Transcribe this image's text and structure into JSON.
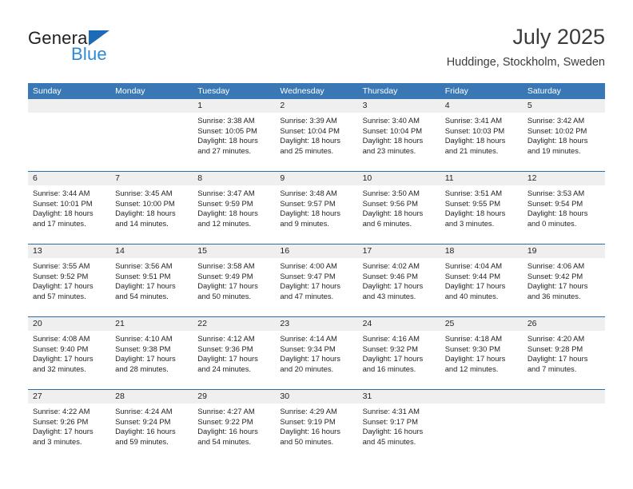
{
  "brand": {
    "name_top": "General",
    "name_bottom": "Blue",
    "triangle_color": "#1c6cb5",
    "blue_color": "#2e8ad6"
  },
  "header": {
    "title": "July 2025",
    "subtitle": "Huddinge, Stockholm, Sweden"
  },
  "theme": {
    "header_blue": "#3a78b5",
    "row_divider": "#2e6ca4",
    "day_band": "#efefef"
  },
  "weekdays": [
    "Sunday",
    "Monday",
    "Tuesday",
    "Wednesday",
    "Thursday",
    "Friday",
    "Saturday"
  ],
  "labels": {
    "sunrise": "Sunrise:",
    "sunset": "Sunset:",
    "daylight": "Daylight:"
  },
  "weeks": [
    [
      {
        "day": ""
      },
      {
        "day": ""
      },
      {
        "day": "1",
        "sunrise": "Sunrise: 3:38 AM",
        "sunset": "Sunset: 10:05 PM",
        "daylight": "Daylight: 18 hours and 27 minutes."
      },
      {
        "day": "2",
        "sunrise": "Sunrise: 3:39 AM",
        "sunset": "Sunset: 10:04 PM",
        "daylight": "Daylight: 18 hours and 25 minutes."
      },
      {
        "day": "3",
        "sunrise": "Sunrise: 3:40 AM",
        "sunset": "Sunset: 10:04 PM",
        "daylight": "Daylight: 18 hours and 23 minutes."
      },
      {
        "day": "4",
        "sunrise": "Sunrise: 3:41 AM",
        "sunset": "Sunset: 10:03 PM",
        "daylight": "Daylight: 18 hours and 21 minutes."
      },
      {
        "day": "5",
        "sunrise": "Sunrise: 3:42 AM",
        "sunset": "Sunset: 10:02 PM",
        "daylight": "Daylight: 18 hours and 19 minutes."
      }
    ],
    [
      {
        "day": "6",
        "sunrise": "Sunrise: 3:44 AM",
        "sunset": "Sunset: 10:01 PM",
        "daylight": "Daylight: 18 hours and 17 minutes."
      },
      {
        "day": "7",
        "sunrise": "Sunrise: 3:45 AM",
        "sunset": "Sunset: 10:00 PM",
        "daylight": "Daylight: 18 hours and 14 minutes."
      },
      {
        "day": "8",
        "sunrise": "Sunrise: 3:47 AM",
        "sunset": "Sunset: 9:59 PM",
        "daylight": "Daylight: 18 hours and 12 minutes."
      },
      {
        "day": "9",
        "sunrise": "Sunrise: 3:48 AM",
        "sunset": "Sunset: 9:57 PM",
        "daylight": "Daylight: 18 hours and 9 minutes."
      },
      {
        "day": "10",
        "sunrise": "Sunrise: 3:50 AM",
        "sunset": "Sunset: 9:56 PM",
        "daylight": "Daylight: 18 hours and 6 minutes."
      },
      {
        "day": "11",
        "sunrise": "Sunrise: 3:51 AM",
        "sunset": "Sunset: 9:55 PM",
        "daylight": "Daylight: 18 hours and 3 minutes."
      },
      {
        "day": "12",
        "sunrise": "Sunrise: 3:53 AM",
        "sunset": "Sunset: 9:54 PM",
        "daylight": "Daylight: 18 hours and 0 minutes."
      }
    ],
    [
      {
        "day": "13",
        "sunrise": "Sunrise: 3:55 AM",
        "sunset": "Sunset: 9:52 PM",
        "daylight": "Daylight: 17 hours and 57 minutes."
      },
      {
        "day": "14",
        "sunrise": "Sunrise: 3:56 AM",
        "sunset": "Sunset: 9:51 PM",
        "daylight": "Daylight: 17 hours and 54 minutes."
      },
      {
        "day": "15",
        "sunrise": "Sunrise: 3:58 AM",
        "sunset": "Sunset: 9:49 PM",
        "daylight": "Daylight: 17 hours and 50 minutes."
      },
      {
        "day": "16",
        "sunrise": "Sunrise: 4:00 AM",
        "sunset": "Sunset: 9:47 PM",
        "daylight": "Daylight: 17 hours and 47 minutes."
      },
      {
        "day": "17",
        "sunrise": "Sunrise: 4:02 AM",
        "sunset": "Sunset: 9:46 PM",
        "daylight": "Daylight: 17 hours and 43 minutes."
      },
      {
        "day": "18",
        "sunrise": "Sunrise: 4:04 AM",
        "sunset": "Sunset: 9:44 PM",
        "daylight": "Daylight: 17 hours and 40 minutes."
      },
      {
        "day": "19",
        "sunrise": "Sunrise: 4:06 AM",
        "sunset": "Sunset: 9:42 PM",
        "daylight": "Daylight: 17 hours and 36 minutes."
      }
    ],
    [
      {
        "day": "20",
        "sunrise": "Sunrise: 4:08 AM",
        "sunset": "Sunset: 9:40 PM",
        "daylight": "Daylight: 17 hours and 32 minutes."
      },
      {
        "day": "21",
        "sunrise": "Sunrise: 4:10 AM",
        "sunset": "Sunset: 9:38 PM",
        "daylight": "Daylight: 17 hours and 28 minutes."
      },
      {
        "day": "22",
        "sunrise": "Sunrise: 4:12 AM",
        "sunset": "Sunset: 9:36 PM",
        "daylight": "Daylight: 17 hours and 24 minutes."
      },
      {
        "day": "23",
        "sunrise": "Sunrise: 4:14 AM",
        "sunset": "Sunset: 9:34 PM",
        "daylight": "Daylight: 17 hours and 20 minutes."
      },
      {
        "day": "24",
        "sunrise": "Sunrise: 4:16 AM",
        "sunset": "Sunset: 9:32 PM",
        "daylight": "Daylight: 17 hours and 16 minutes."
      },
      {
        "day": "25",
        "sunrise": "Sunrise: 4:18 AM",
        "sunset": "Sunset: 9:30 PM",
        "daylight": "Daylight: 17 hours and 12 minutes."
      },
      {
        "day": "26",
        "sunrise": "Sunrise: 4:20 AM",
        "sunset": "Sunset: 9:28 PM",
        "daylight": "Daylight: 17 hours and 7 minutes."
      }
    ],
    [
      {
        "day": "27",
        "sunrise": "Sunrise: 4:22 AM",
        "sunset": "Sunset: 9:26 PM",
        "daylight": "Daylight: 17 hours and 3 minutes."
      },
      {
        "day": "28",
        "sunrise": "Sunrise: 4:24 AM",
        "sunset": "Sunset: 9:24 PM",
        "daylight": "Daylight: 16 hours and 59 minutes."
      },
      {
        "day": "29",
        "sunrise": "Sunrise: 4:27 AM",
        "sunset": "Sunset: 9:22 PM",
        "daylight": "Daylight: 16 hours and 54 minutes."
      },
      {
        "day": "30",
        "sunrise": "Sunrise: 4:29 AM",
        "sunset": "Sunset: 9:19 PM",
        "daylight": "Daylight: 16 hours and 50 minutes."
      },
      {
        "day": "31",
        "sunrise": "Sunrise: 4:31 AM",
        "sunset": "Sunset: 9:17 PM",
        "daylight": "Daylight: 16 hours and 45 minutes."
      },
      {
        "day": ""
      },
      {
        "day": ""
      }
    ]
  ]
}
